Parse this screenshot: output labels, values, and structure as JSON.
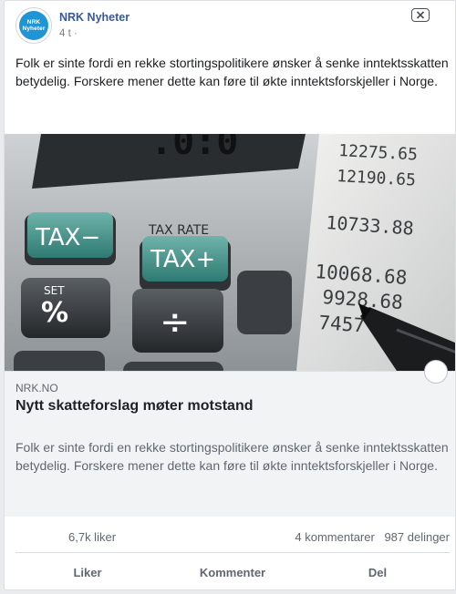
{
  "post": {
    "page_name": "NRK Nyheter",
    "avatar_text_line1": "NRK",
    "avatar_text_line2": "Nyheter",
    "time": "4 t ·",
    "text": "Folk er sinte fordi en rekke stortingspolitikere ønsker å senke inntektsskatten betydelig. Forskere mener dette kan føre til økte inntektsforskjeller i Norge."
  },
  "image": {
    "keys": {
      "tax_minus": "TAX−",
      "tax_plus": "TAX+",
      "tax_rate": "TAX RATE",
      "set": "SET",
      "percent": "%",
      "divide": "÷"
    },
    "paper_numbers": [
      "12275.65",
      "12190.65",
      "10733.88",
      "10068.68",
      "9928.68",
      "7457"
    ]
  },
  "link": {
    "domain": "NRK.NO",
    "headline": "Nytt skatteforslag møter motstand",
    "description": "Folk er sinte fordi en rekke stortingspolitikere ønsker å senke inntektsskatten betydelig. Forskere mener dette kan føre til økte inntektsforskjeller i Norge."
  },
  "stats": {
    "likes": "6,7k liker",
    "comments": "4 kommentarer",
    "shares": "987 delinger"
  },
  "actions": {
    "like": "Liker",
    "comment": "Kommenter",
    "share": "Del"
  },
  "colors": {
    "brand_blue": "#385898",
    "avatar_blue": "#1f95d6",
    "tax_key_green": "#3d8f86"
  },
  "icons": {
    "close": "close-icon",
    "avatar": "nrk-logo"
  }
}
